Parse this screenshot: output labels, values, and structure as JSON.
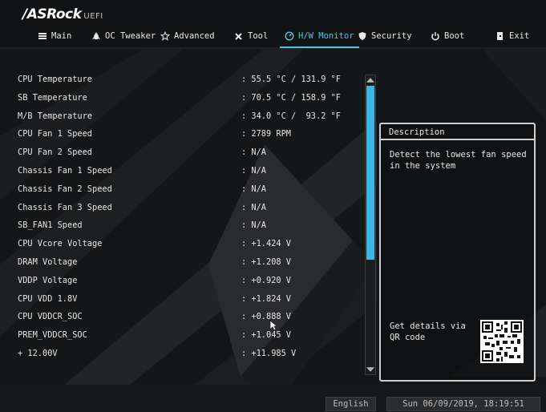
{
  "logo": {
    "brand": "/ASRock",
    "suffix": "UEFI"
  },
  "nav": {
    "tabs": [
      {
        "label": "Main",
        "icon": "menu-list-icon"
      },
      {
        "label": "OC Tweaker",
        "icon": "rocket-icon"
      },
      {
        "label": "Advanced",
        "icon": "star-icon"
      },
      {
        "label": "Tool",
        "icon": "tools-icon"
      },
      {
        "label": "H/W Monitor",
        "icon": "monitor-gauge-icon",
        "active": true
      },
      {
        "label": "Security",
        "icon": "shield-icon"
      },
      {
        "label": "Boot",
        "icon": "power-icon"
      },
      {
        "label": "Exit",
        "icon": "exit-door-icon"
      }
    ]
  },
  "monitor": {
    "rows": [
      {
        "label": "CPU Temperature",
        "value": ": 55.5 °C / 131.9 °F"
      },
      {
        "label": "SB Temperature",
        "value": ": 70.5 °C / 158.9 °F"
      },
      {
        "label": "M/B Temperature",
        "value": ": 34.0 °C /  93.2 °F"
      },
      {
        "label": "CPU Fan 1 Speed",
        "value": ": 2789 RPM"
      },
      {
        "label": "CPU Fan 2 Speed",
        "value": ": N/A"
      },
      {
        "label": "Chassis Fan 1 Speed",
        "value": ": N/A"
      },
      {
        "label": "Chassis Fan 2 Speed",
        "value": ": N/A"
      },
      {
        "label": "Chassis Fan 3 Speed",
        "value": ": N/A"
      },
      {
        "label": "SB_FAN1 Speed",
        "value": ": N/A"
      },
      {
        "label": "CPU Vcore Voltage",
        "value": ": +1.424 V"
      },
      {
        "label": "DRAM Voltage",
        "value": ": +1.208 V"
      },
      {
        "label": "VDDP Voltage",
        "value": ": +0.920 V"
      },
      {
        "label": "CPU VDD 1.8V",
        "value": ": +1.824 V"
      },
      {
        "label": "CPU VDDCR_SOC",
        "value": ": +0.888 V"
      },
      {
        "label": "PREM_VDDCR_SOC",
        "value": ": +1.045 V"
      },
      {
        "label": "+ 12.00V",
        "value": ": +11.985 V"
      }
    ]
  },
  "description": {
    "title": "Description",
    "text": "Detect the lowest fan speed in the system",
    "qr_text": "Get details via QR code"
  },
  "footer": {
    "language": "English",
    "datetime": "Sun 06/09/2019, 18:19:51"
  },
  "colors": {
    "accent": "#3ab7e3",
    "background": "#141516",
    "text": "#e6e6e6"
  }
}
